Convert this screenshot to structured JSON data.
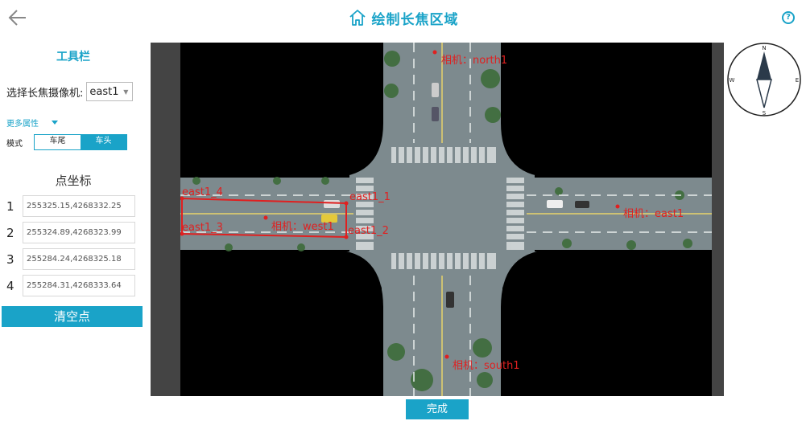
{
  "header": {
    "title": "绘制长焦区域"
  },
  "toolbar": {
    "title": "工具栏",
    "camera_label": "选择长焦摄像机:",
    "camera_value": "east1",
    "more_attrs": "更多属性",
    "mode_label": "模式",
    "mode_options": [
      "车尾",
      "车头"
    ],
    "mode_selected": "车头"
  },
  "points": {
    "title": "点坐标",
    "items": [
      {
        "index": "1",
        "value": "255325.15,4268332.25"
      },
      {
        "index": "2",
        "value": "255324.89,4268323.99"
      },
      {
        "index": "3",
        "value": "255284.24,4268325.18"
      },
      {
        "index": "4",
        "value": "255284.31,4268333.64"
      }
    ],
    "clear_label": "清空点"
  },
  "map": {
    "cameras": [
      "相机：north1",
      "相机：east1",
      "相机：west1",
      "相机：south1"
    ],
    "corner_labels": [
      "east1_1",
      "east1_2",
      "east1_3",
      "east1_4"
    ]
  },
  "compass": {
    "n": "N",
    "s": "S",
    "e": "E",
    "w": "W"
  },
  "footer": {
    "done_label": "完成"
  },
  "colors": {
    "accent": "#1aa3c8",
    "marker": "#e02020"
  }
}
